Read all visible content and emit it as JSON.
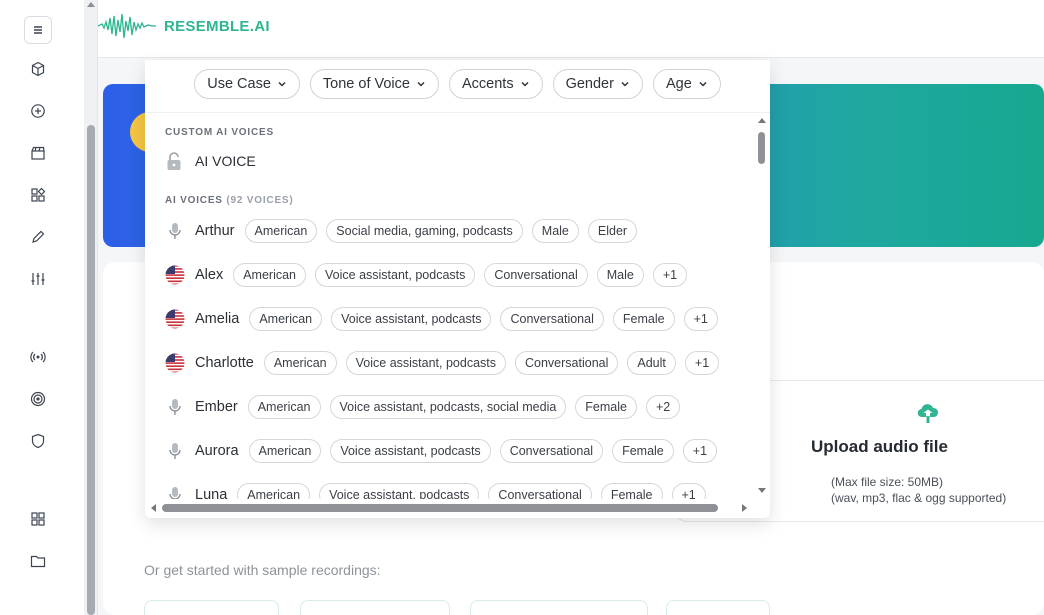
{
  "app": {
    "logo_text": "RESEMBLE.AI",
    "brand_color": "#2fb592"
  },
  "rail": {
    "icons": [
      "menu-icon",
      "cube-icon",
      "plus-circle-icon",
      "clapperboard-icon",
      "widgets-icon",
      "pencil-icon",
      "sliders-icon",
      "broadcast-icon",
      "target-icon",
      "shield-icon",
      "grid-icon",
      "folder-icon"
    ]
  },
  "filters": [
    {
      "label": "Use Case"
    },
    {
      "label": "Tone of Voice"
    },
    {
      "label": "Accents"
    },
    {
      "label": "Gender"
    },
    {
      "label": "Age"
    }
  ],
  "custom_section": {
    "label": "CUSTOM AI VOICES",
    "item": "AI VOICE"
  },
  "ai_section": {
    "label": "AI VOICES",
    "count": "(92 VOICES)"
  },
  "voices": [
    {
      "name": "Arthur",
      "icon": "microphone-icon",
      "tags": [
        "American",
        "Social media, gaming, podcasts",
        "Male",
        "Elder"
      ]
    },
    {
      "name": "Alex",
      "icon": "us-flag-icon",
      "tags": [
        "American",
        "Voice assistant, podcasts",
        "Conversational",
        "Male",
        "+1"
      ]
    },
    {
      "name": "Amelia",
      "icon": "us-flag-icon",
      "tags": [
        "American",
        "Voice assistant, podcasts",
        "Conversational",
        "Female",
        "+1"
      ]
    },
    {
      "name": "Charlotte",
      "icon": "us-flag-icon",
      "tags": [
        "American",
        "Voice assistant, podcasts",
        "Conversational",
        "Adult",
        "+1"
      ]
    },
    {
      "name": "Ember",
      "icon": "microphone-icon",
      "tags": [
        "American",
        "Voice assistant, podcasts, social media",
        "Female",
        "+2"
      ]
    },
    {
      "name": "Aurora",
      "icon": "microphone-icon",
      "tags": [
        "American",
        "Voice assistant, podcasts",
        "Conversational",
        "Female",
        "+1"
      ]
    },
    {
      "name": "Luna",
      "icon": "microphone-icon",
      "tags": [
        "American",
        "Voice assistant, podcasts",
        "Conversational",
        "Female",
        "+1"
      ]
    }
  ],
  "upload": {
    "title": "Upload audio file",
    "size_note": "(Max file size: 50MB)",
    "formats_note": "(wav, mp3, flac & ogg supported)"
  },
  "samples": {
    "label": "Or get started with sample recordings:"
  }
}
